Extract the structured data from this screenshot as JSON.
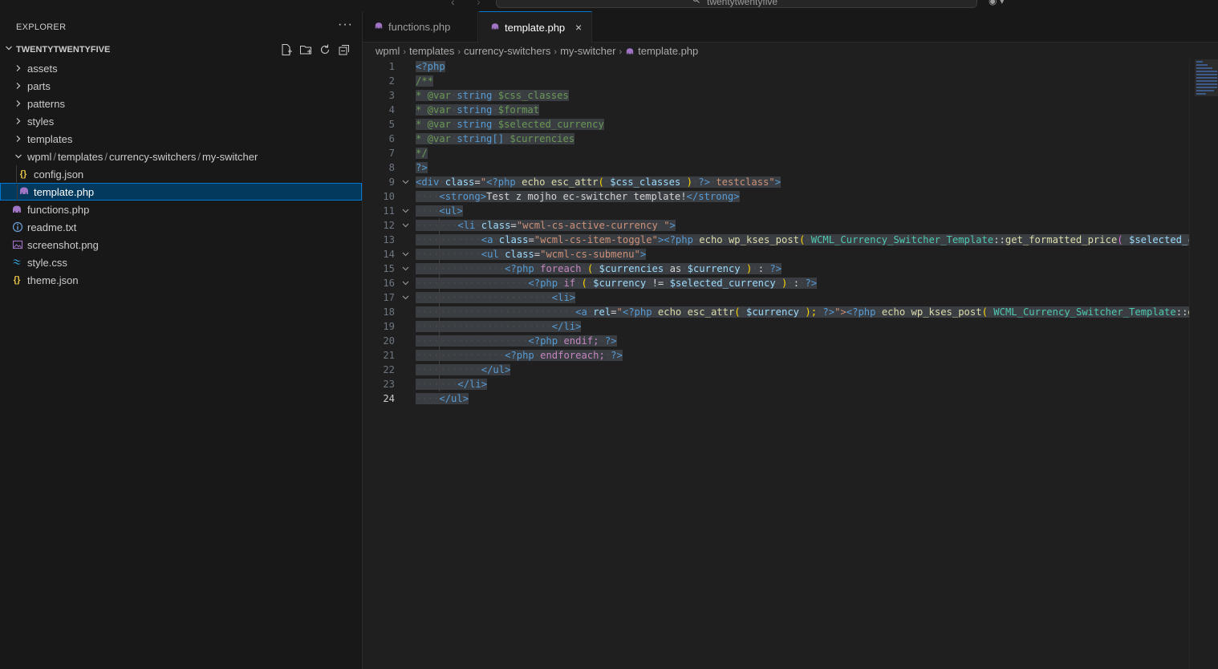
{
  "titlebar": {
    "back_glyph": "‹",
    "forward_glyph": "›",
    "search_text": "twentytwentyfive",
    "copilot_glyph": "◉ ▾"
  },
  "sidebar": {
    "header": "EXPLORER",
    "more_glyph": "···",
    "folder": "TWENTYTWENTYFIVE",
    "tree": [
      {
        "label": "assets",
        "type": "folder"
      },
      {
        "label": "parts",
        "type": "folder"
      },
      {
        "label": "patterns",
        "type": "folder"
      },
      {
        "label": "styles",
        "type": "folder"
      },
      {
        "label": "templates",
        "type": "folder"
      },
      {
        "path_parts": [
          "wpml",
          "templates",
          "currency-switchers",
          "my-switcher"
        ],
        "type": "folder-open"
      },
      {
        "label": "config.json",
        "type": "json"
      },
      {
        "label": "template.php",
        "type": "php",
        "selected": true
      },
      {
        "label": "functions.php",
        "type": "php"
      },
      {
        "label": "readme.txt",
        "type": "info"
      },
      {
        "label": "screenshot.png",
        "type": "image"
      },
      {
        "label": "style.css",
        "type": "css"
      },
      {
        "label": "theme.json",
        "type": "json"
      }
    ]
  },
  "tabs": [
    {
      "label": "functions.php",
      "active": false
    },
    {
      "label": "template.php",
      "active": true
    }
  ],
  "tab_close_glyph": "×",
  "breadcrumb": [
    "wpml",
    "templates",
    "currency-switchers",
    "my-switcher",
    "template.php"
  ],
  "editor": {
    "lines": [
      "1",
      "2",
      "3",
      "4",
      "5",
      "6",
      "7",
      "8",
      "9",
      "10",
      "11",
      "12",
      "13",
      "14",
      "15",
      "16",
      "17",
      "18",
      "19",
      "20",
      "21",
      "22",
      "23",
      "24"
    ],
    "active_line": "24",
    "code": {
      "l1": "<?php",
      "l2": "/**",
      "l3a": "* @var",
      "l3b": "string",
      "l3c": "$css_classes",
      "l4a": "* @var",
      "l4b": "string",
      "l4c": "$format",
      "l5a": "* @var",
      "l5b": "string",
      "l5c": "$selected_currency",
      "l6a": "* @var",
      "l6b": "string[]",
      "l6c": "$currencies",
      "l7": "*/",
      "l8": "?>",
      "l9": {
        "tag_open": "<div",
        "attr": "class",
        "eq": "=",
        "q": "\"",
        "php_open": "<?php",
        "echo": "echo",
        "fn": "esc_attr",
        "p_open": "(",
        "var": "$css_classes",
        "p_close": ")",
        "php_close": "?>",
        "rest": "testclass\"",
        "tag_close": ">"
      },
      "l10": {
        "open": "<strong>",
        "text": "Test z mojho ec-switcher template!",
        "close": "</strong>"
      },
      "l11": "<ul>",
      "l12": {
        "tag_open": "<li",
        "attr": "class",
        "eq": "=",
        "val": "\"wcml-cs-active-currency \"",
        "tag_close": ">"
      },
      "l13": {
        "tag_open": "<a",
        "attr": "class",
        "eq": "=",
        "val": "\"wcml-cs-item-toggle\"",
        "tag_close": ">",
        "php_open": "<?php",
        "echo": "echo",
        "fn": "wp_kses_post",
        "p_open": "(",
        "cls": "WCML_Currency_Switcher_Template",
        "sep": "::",
        "method": "get_formatted_price",
        "p2": "(",
        "var": "$selected_cu"
      },
      "l14": {
        "tag_open": "<ul",
        "attr": "class",
        "eq": "=",
        "val": "\"wcml-cs-submenu\"",
        "tag_close": ">"
      },
      "l15": {
        "php_open": "<?php",
        "kw": "foreach",
        "p_open": "(",
        "var1": "$currencies",
        "as": "as",
        "var2": "$currency",
        "p_close": ")",
        "colon": ":",
        "php_close": "?>"
      },
      "l16": {
        "php_open": "<?php",
        "kw": "if",
        "p_open": "(",
        "var1": "$currency",
        "op": "!=",
        "var2": "$selected_currency",
        "p_close": ")",
        "colon": ":",
        "php_close": "?>"
      },
      "l17": "<li>",
      "l18": {
        "tag_open": "<a",
        "attr": "rel",
        "eq": "=",
        "q": "\"",
        "php_open": "<?php",
        "echo": "echo",
        "fn": "esc_attr",
        "p_open": "(",
        "var": "$currency",
        "p_close": ");",
        "php_close": "?>",
        "q2": "\">",
        "php_open2": "<?php",
        "echo2": "echo",
        "fn2": "wp_kses_post",
        "p_open2": "(",
        "cls": "WCML_Currency_Switcher_Template",
        "sep": "::",
        "tail": "ge"
      },
      "l19": "</li>",
      "l20": {
        "php_open": "<?php",
        "kw": "endif;",
        "php_close": "?>"
      },
      "l21": {
        "php_open": "<?php",
        "kw": "endforeach;",
        "php_close": "?>"
      },
      "l22": "</ul>",
      "l23": "</li>",
      "l24": "</ul>"
    }
  },
  "colors": {
    "sidebar_bg": "#181818",
    "editor_bg": "#1f1f1f",
    "selection": "#04395e",
    "focus_border": "#0078d4",
    "php_icon": "#a074c4"
  }
}
